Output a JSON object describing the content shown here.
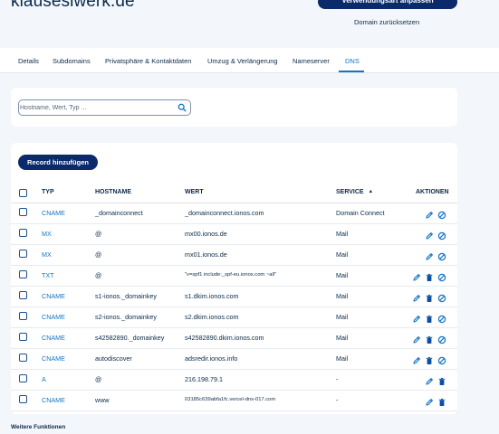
{
  "header": {
    "domain": "klauseslwerk.de",
    "usage_button": "Verwendungsart anpassen",
    "reset_link": "Domain zurücksetzen"
  },
  "tabs": [
    {
      "label": "Details"
    },
    {
      "label": "Subdomains"
    },
    {
      "label": "Privatsphäre & Kontaktdaten"
    },
    {
      "label": "Umzug & Verlängerung"
    },
    {
      "label": "Nameserver"
    },
    {
      "label": "DNS"
    }
  ],
  "active_tab": "DNS",
  "search": {
    "placeholder": "Hostname, Wert, Typ ..."
  },
  "add_button": "Record hinzufügen",
  "table": {
    "columns": [
      "TYP",
      "HOSTNAME",
      "WERT",
      "SERVICE",
      "AKTIONEN"
    ],
    "sort_indicator": "▲",
    "rows": [
      {
        "type": "CNAME",
        "host": "_domainconnect",
        "value": "_domainconnect.ionos.com",
        "service": "Domain Connect",
        "actions": [
          "edit",
          "block"
        ]
      },
      {
        "type": "MX",
        "host": "@",
        "value": "mx00.ionos.de",
        "service": "Mail",
        "actions": [
          "edit",
          "block"
        ]
      },
      {
        "type": "MX",
        "host": "@",
        "value": "mx01.ionos.de",
        "service": "Mail",
        "actions": [
          "edit",
          "block"
        ]
      },
      {
        "type": "TXT",
        "host": "@",
        "value": "\"v=spf1 include:_spf-eu.ionos.com ~all\"",
        "service": "Mail",
        "actions": [
          "edit",
          "delete",
          "block"
        ]
      },
      {
        "type": "CNAME",
        "host": "s1-ionos._domainkey",
        "value": "s1.dkim.ionos.com",
        "service": "Mail",
        "actions": [
          "edit",
          "delete",
          "block"
        ]
      },
      {
        "type": "CNAME",
        "host": "s2-ionos._domainkey",
        "value": "s2.dkim.ionos.com",
        "service": "Mail",
        "actions": [
          "edit",
          "delete",
          "block"
        ]
      },
      {
        "type": "CNAME",
        "host": "s42582890._domainkey",
        "value": "s42582890.dkim.ionos.com",
        "service": "Mail",
        "actions": [
          "edit",
          "delete",
          "block"
        ]
      },
      {
        "type": "CNAME",
        "host": "autodiscover",
        "value": "adsredir.ionos.info",
        "service": "Mail",
        "actions": [
          "edit",
          "delete",
          "block"
        ]
      },
      {
        "type": "A",
        "host": "@",
        "value": "216.198.79.1",
        "service": "-",
        "actions": [
          "edit",
          "delete"
        ]
      },
      {
        "type": "CNAME",
        "host": "www",
        "value": "03185c639abfa1fc.vercel-dns-017.com",
        "service": "-",
        "actions": [
          "edit",
          "delete"
        ]
      }
    ]
  },
  "footer": {
    "title": "Weitere Funktionen"
  },
  "colors": {
    "primary_button": "#0b2a6b",
    "accent": "#1474c4",
    "text": "#0b2a4a"
  }
}
